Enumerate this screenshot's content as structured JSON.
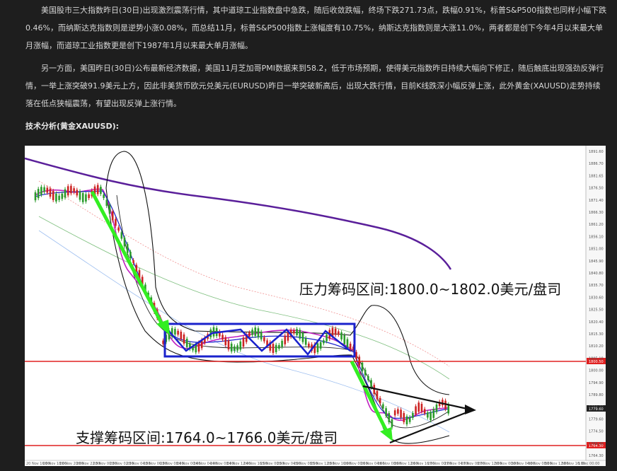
{
  "article": {
    "paragraph1": "美国股市三大指数昨日(30日)出现激烈震荡行情，其中道琼工业指数盘中急跌，随后收敛跌幅，终场下跌271.73点，跌幅0.91%，标普S&P500指数也同样小幅下跌0.46%，而纳斯达克指数则是逆势小涨0.08%，而总结11月，标普S&P500指数上涨幅度有10.75%，纳斯达克指数则是大涨11.0%，两者都是创下今年4月以来最大单月涨幅，而道琼工业指数更是创下1987年1月以来最大单月涨幅。",
    "paragraph2": "另一方面，美国昨日(30日)公布最新经济数据，美国11月芝加哥PMI数据来到58.2，低于市场预期，使得美元指数昨日持续大幅向下修正，随后触底出现强劲反弹行情，一举上涨突破91.9美元上方，因此非美货币欧元兑美元(EURUSD)昨日一举突破新高后，出现大跌行情，目前K线跌深小幅反弹上涨，此外黄金(XAUUSD)走势持续落在低点狭幅震荡，有望出现反弹上涨行情。",
    "heading": "技术分析(黄金XAUUSD):"
  },
  "chart": {
    "resistance_label": "压力筹码区间:1800.0~1802.0美元/盘司",
    "support_label": "支撑筹码区间:1764.0~1766.0美元/盘司",
    "price_ticks": [
      "1891.60",
      "1886.70",
      "1881.65",
      "1876.50",
      "1871.40",
      "1866.30",
      "1861.20",
      "1856.10",
      "1851.00",
      "1845.90",
      "1840.80",
      "1835.70",
      "1830.60",
      "1825.50",
      "1820.40",
      "1815.30",
      "1810.20",
      "1805.10",
      "1800.00",
      "1794.90",
      "1789.80",
      "1784.70",
      "1779.60",
      "1774.50",
      "1769.40",
      "1764.30"
    ],
    "current_price_tag": "1779.60",
    "resistance_tag": "1800.50",
    "support_tag": "1764.30",
    "time_ticks": [
      "20 Nov 16:00",
      "20 Nov 18:00",
      "20 Nov 20:00",
      "20 Nov 22:00",
      "23 Nov 00:00",
      "23 Nov 02:00",
      "23 Nov 04:00",
      "23 Nov 06:00",
      "23 Nov 08:00",
      "24 Nov 00:00",
      "24 Nov 04:00",
      "24 Nov 08:00",
      "24 Nov 12:00",
      "24 Nov 16:00",
      "25 Nov 00:00",
      "25 Nov 04:00",
      "25 Nov 08:00",
      "25 Nov 12:00",
      "25 Nov 16:00",
      "26 Nov 00:00",
      "26 Nov 04:00",
      "26 Nov 08:00",
      "26 Nov 12:00",
      "26 Nov 16:00",
      "27 Nov 00:00",
      "27 Nov 04:00",
      "27 Nov 08:00",
      "27 Nov 12:00",
      "30 Nov 00:00",
      "30 Nov 04:00",
      "30 Nov 08:00",
      "30 Nov 12:00",
      "30 Nov 16:00",
      "1 Dec 00:00"
    ],
    "colors": {
      "resistance_line": "#e02020",
      "box": "#1a22cc",
      "arrows_down": "#33ee22",
      "ma_long": "#5a1f9a",
      "bollinger": "#111111",
      "triangle": "#111111"
    }
  }
}
